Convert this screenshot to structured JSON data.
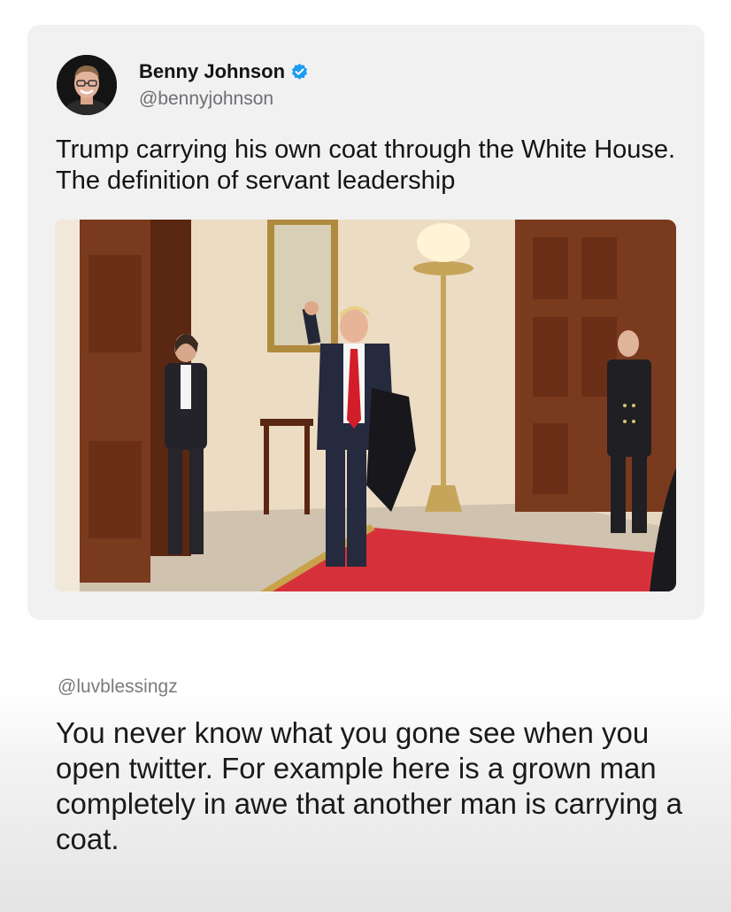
{
  "tweet": {
    "author_name": "Benny Johnson",
    "author_handle": "@bennyjohnson",
    "verified_icon": "verified-badge-icon",
    "text": "Trump carrying his own coat through the White House. The definition of servant leadership",
    "media_alt": "Trump carrying his coat through the White House",
    "colors": {
      "badge": "#1d9bf0",
      "carpet": "#d6313b"
    }
  },
  "reply": {
    "handle": "@luvblessingz",
    "text": "You never know what you gone see when you open twitter. For example here is a grown man completely in awe that another man is carrying a coat."
  }
}
